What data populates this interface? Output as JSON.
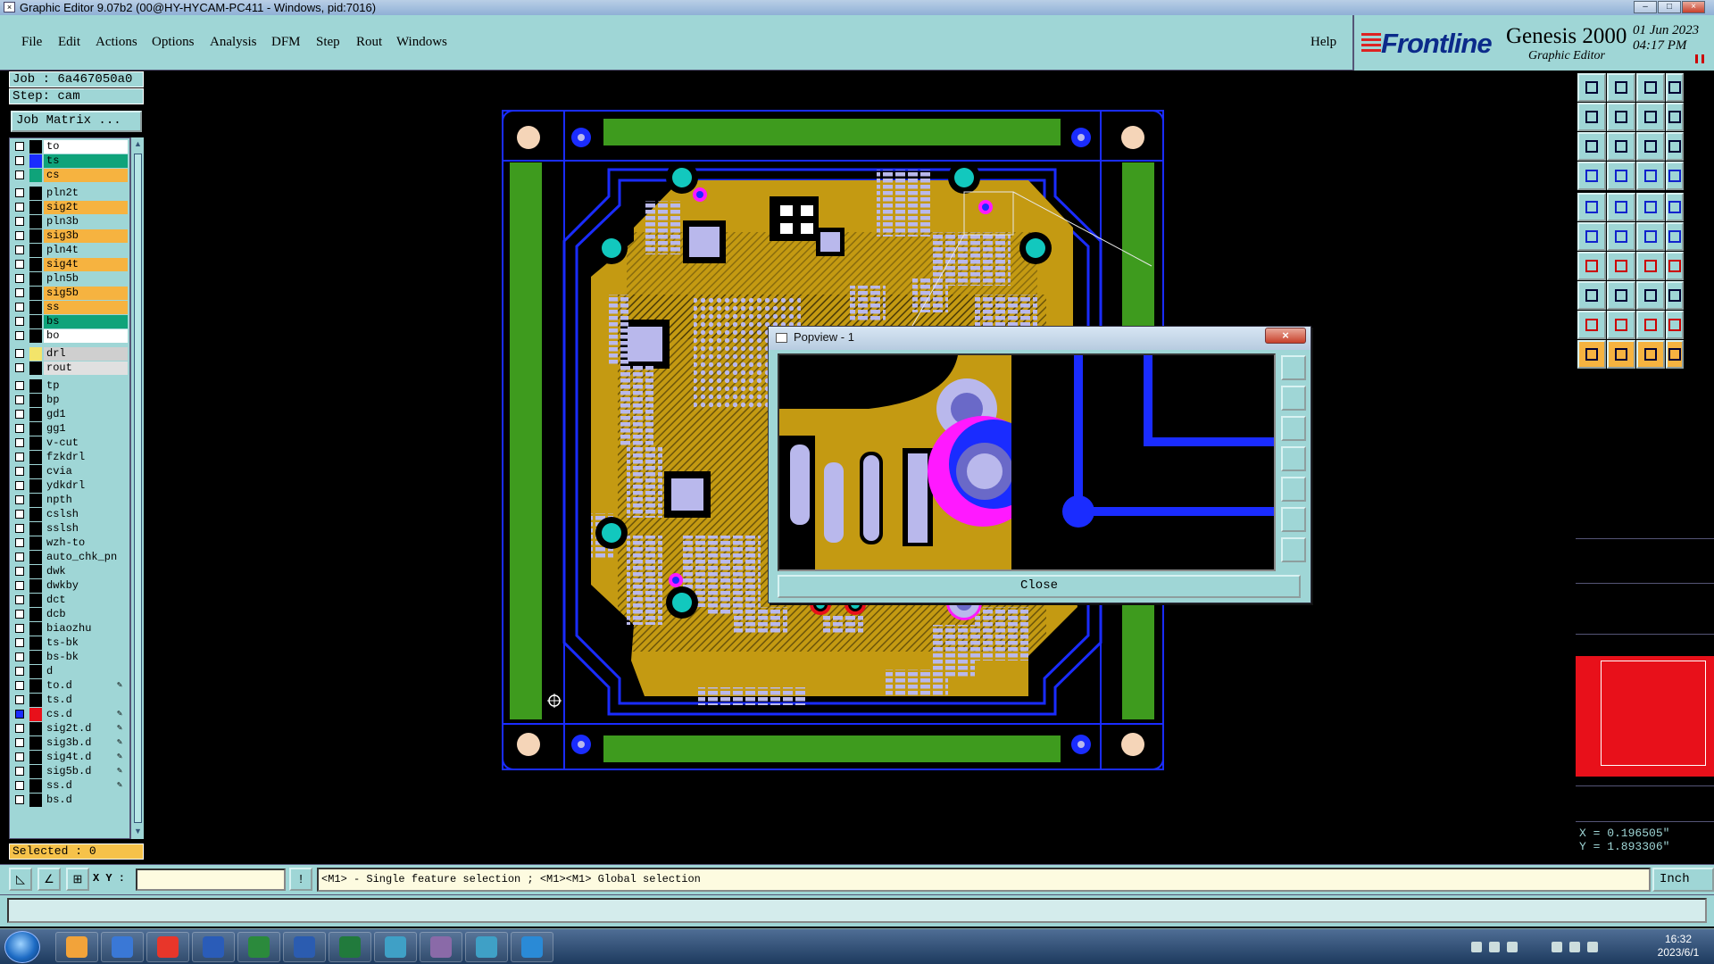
{
  "window": {
    "title": "Graphic Editor 9.07b2 (00@HY-HYCAM-PC411 - Windows, pid:7016)",
    "min_icon": "minimize-icon",
    "max_icon": "maximize-icon",
    "close_icon": "close-icon"
  },
  "menu": {
    "items": [
      "File",
      "Edit",
      "Actions",
      "Options",
      "Analysis",
      "DFM",
      "Step",
      "Rout",
      "Windows"
    ],
    "help": "Help"
  },
  "brand": {
    "logo": "Frontline",
    "product": "Genesis 2000",
    "subtitle": "Graphic Editor",
    "date": "01 Jun 2023",
    "time": "04:17 PM"
  },
  "job": {
    "job_label": "Job : 6a467050a0",
    "step_label": "Step: cam",
    "matrix_button": "Job Matrix ..."
  },
  "layers": [
    {
      "name": "to",
      "swatch": "#000000",
      "bg": "#ffffff"
    },
    {
      "name": "ts",
      "swatch": "#1a2cff",
      "bg": "#0fa37a"
    },
    {
      "name": "cs",
      "swatch": "#0fa37a",
      "bg": "#f6b340"
    },
    {
      "name": "pln2t",
      "swatch": "#000000",
      "bg": "#9fd6d6",
      "gap": true
    },
    {
      "name": "sig2t",
      "swatch": "#000000",
      "bg": "#f6b340"
    },
    {
      "name": "pln3b",
      "swatch": "#000000",
      "bg": "#9fd6d6"
    },
    {
      "name": "sig3b",
      "swatch": "#000000",
      "bg": "#f6b340"
    },
    {
      "name": "pln4t",
      "swatch": "#000000",
      "bg": "#9fd6d6"
    },
    {
      "name": "sig4t",
      "swatch": "#000000",
      "bg": "#f6b340"
    },
    {
      "name": "pln5b",
      "swatch": "#000000",
      "bg": "#9fd6d6"
    },
    {
      "name": "sig5b",
      "swatch": "#000000",
      "bg": "#f6b340"
    },
    {
      "name": "ss",
      "swatch": "#000000",
      "bg": "#f6b340"
    },
    {
      "name": "bs",
      "swatch": "#000000",
      "bg": "#0fa37a"
    },
    {
      "name": "bo",
      "swatch": "#000000",
      "bg": "#ffffff"
    },
    {
      "name": "drl",
      "swatch": "#f3e46a",
      "bg": "#cfcfcf",
      "gap": true
    },
    {
      "name": "rout",
      "swatch": "#000000",
      "bg": "#e0e0e0"
    },
    {
      "name": "tp",
      "swatch": "#000000",
      "bg": "#9fd6d6",
      "gap": true
    },
    {
      "name": "bp",
      "swatch": "#000000",
      "bg": "#9fd6d6"
    },
    {
      "name": "gd1",
      "swatch": "#000000",
      "bg": "#9fd6d6"
    },
    {
      "name": "gg1",
      "swatch": "#000000",
      "bg": "#9fd6d6"
    },
    {
      "name": "v-cut",
      "swatch": "#000000",
      "bg": "#9fd6d6"
    },
    {
      "name": "fzkdrl",
      "swatch": "#000000",
      "bg": "#9fd6d6"
    },
    {
      "name": "cvia",
      "swatch": "#000000",
      "bg": "#9fd6d6"
    },
    {
      "name": "ydkdrl",
      "swatch": "#000000",
      "bg": "#9fd6d6"
    },
    {
      "name": "npth",
      "swatch": "#000000",
      "bg": "#9fd6d6"
    },
    {
      "name": "cslsh",
      "swatch": "#000000",
      "bg": "#9fd6d6"
    },
    {
      "name": "sslsh",
      "swatch": "#000000",
      "bg": "#9fd6d6"
    },
    {
      "name": "wzh-to",
      "swatch": "#000000",
      "bg": "#9fd6d6"
    },
    {
      "name": "auto_chk_pn",
      "swatch": "#000000",
      "bg": "#9fd6d6"
    },
    {
      "name": "dwk",
      "swatch": "#000000",
      "bg": "#9fd6d6"
    },
    {
      "name": "dwkby",
      "swatch": "#000000",
      "bg": "#9fd6d6"
    },
    {
      "name": "dct",
      "swatch": "#000000",
      "bg": "#9fd6d6"
    },
    {
      "name": "dcb",
      "swatch": "#000000",
      "bg": "#9fd6d6"
    },
    {
      "name": "biaozhu",
      "swatch": "#000000",
      "bg": "#9fd6d6"
    },
    {
      "name": "ts-bk",
      "swatch": "#000000",
      "bg": "#9fd6d6"
    },
    {
      "name": "bs-bk",
      "swatch": "#000000",
      "bg": "#9fd6d6"
    },
    {
      "name": "d",
      "swatch": "#000000",
      "bg": "#9fd6d6"
    },
    {
      "name": "to.d",
      "swatch": "#000000",
      "bg": "#9fd6d6",
      "edit": "pencil-icon"
    },
    {
      "name": "ts.d",
      "swatch": "#000000",
      "bg": "#9fd6d6"
    },
    {
      "name": "cs.d",
      "swatch": "#e8101a",
      "bg": "#9fd6d6",
      "edit": "pencil-icon",
      "active": true
    },
    {
      "name": "sig2t.d",
      "swatch": "#000000",
      "bg": "#9fd6d6",
      "edit": "pencil-icon"
    },
    {
      "name": "sig3b.d",
      "swatch": "#000000",
      "bg": "#9fd6d6",
      "edit": "pencil-icon"
    },
    {
      "name": "sig4t.d",
      "swatch": "#000000",
      "bg": "#9fd6d6",
      "edit": "pencil-icon"
    },
    {
      "name": "sig5b.d",
      "swatch": "#000000",
      "bg": "#9fd6d6",
      "edit": "pencil-icon"
    },
    {
      "name": "ss.d",
      "swatch": "#000000",
      "bg": "#9fd6d6",
      "edit": "pencil-icon"
    },
    {
      "name": "bs.d",
      "swatch": "#000000",
      "bg": "#9fd6d6"
    }
  ],
  "selected_label": "Selected : 0",
  "popview": {
    "title": "Popview - 1",
    "close_button": "Close",
    "close_x": "×"
  },
  "coords": {
    "x_label": "X = 0.196505\"",
    "y_label": "Y = 1.893306\""
  },
  "command": {
    "xy_label": "X Y :",
    "xy_value": "",
    "alert_icon": "!",
    "message": "<M1> - Single feature selection ; <M1><M1> Global selection",
    "unit": "Inch"
  },
  "taskbar": {
    "apps": [
      "shell-icon",
      "notepad-icon",
      "browser-icon",
      "save-disk-icon",
      "publisher-icon",
      "word-icon",
      "excel-icon",
      "eye-viewer-icon",
      "genesis-icon",
      "eye-viewer-icon",
      "arrow-app-icon"
    ],
    "time": "16:32",
    "date": "2023/6/1"
  },
  "colors": {
    "panel": "#9fd6d6",
    "copper": "#c49a12",
    "trace": "#1a2cff",
    "soldermask_green": "#3e9b1e",
    "pad": "#b9b8ec",
    "cyan_pad": "#12c8be",
    "magenta_via": "#ff19ff"
  }
}
